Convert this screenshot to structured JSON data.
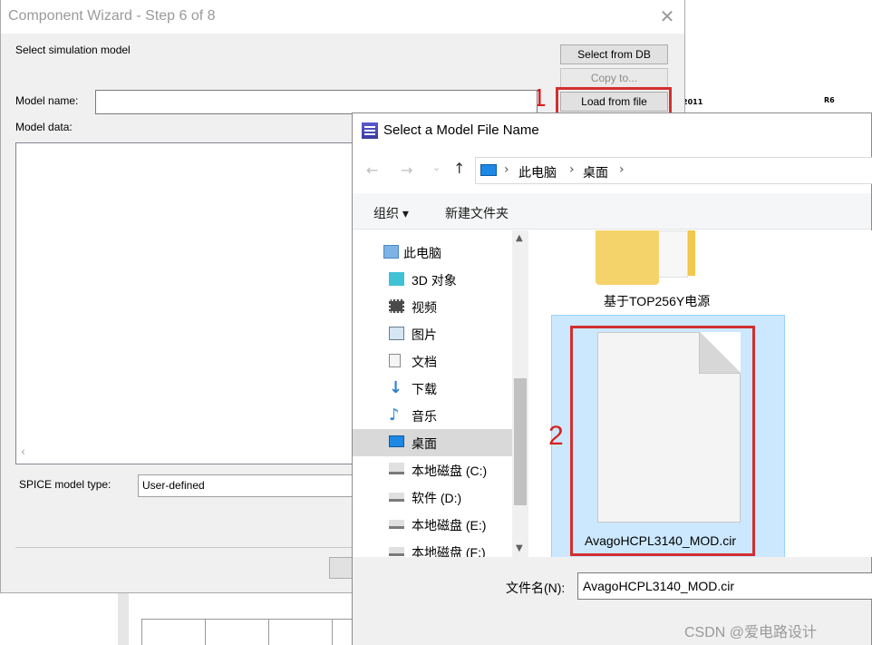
{
  "wizard": {
    "title": "Component Wizard - Step 6 of 8",
    "close_glyph": "✕",
    "select_sim_label": "Select simulation model",
    "model_name_label": "Model name:",
    "model_name_value": "",
    "model_data_label": "Model data:",
    "model_data_value": "",
    "spice_type_label": "SPICE model type:",
    "spice_type_value": "User-defined",
    "buttons": {
      "select_from_db": "Select from DB",
      "copy_to": "Copy to...",
      "load_from_file": "Load from file"
    }
  },
  "annotations": {
    "step1": "1",
    "step2": "2",
    "highlight_color": "#d32f2f"
  },
  "schematic": {
    "label_left": "2011",
    "label_r6": "R6"
  },
  "file_dialog": {
    "title": "Select a Model File Name",
    "icon": "app-icon",
    "breadcrumbs": [
      "此电脑",
      "桌面"
    ],
    "toolbar": {
      "organize": "组织 ▾",
      "new_folder": "新建文件夹"
    },
    "nav_items": [
      {
        "label": "此电脑",
        "icon": "computer-icon"
      },
      {
        "label": "3D 对象",
        "icon": "cube-3d-icon"
      },
      {
        "label": "视频",
        "icon": "video-icon"
      },
      {
        "label": "图片",
        "icon": "pictures-icon"
      },
      {
        "label": "文档",
        "icon": "documents-icon"
      },
      {
        "label": "下载",
        "icon": "download-icon"
      },
      {
        "label": "音乐",
        "icon": "music-icon"
      },
      {
        "label": "桌面",
        "icon": "desktop-icon"
      },
      {
        "label": "本地磁盘 (C:)",
        "icon": "windows-drive-icon"
      },
      {
        "label": "软件 (D:)",
        "icon": "drive-icon"
      },
      {
        "label": "本地磁盘 (E:)",
        "icon": "drive-icon"
      },
      {
        "label": "本地磁盘 (F:)",
        "icon": "drive-icon"
      }
    ],
    "files": [
      {
        "name": "基于TOP256Y电源",
        "type": "folder"
      },
      {
        "name": "AvagoHCPL3140_MOD.cir",
        "type": "file"
      }
    ],
    "filename_label": "文件名(N):",
    "filename_value": "AvagoHCPL3140_MOD.cir"
  },
  "watermark": "CSDN @爱电路设计"
}
